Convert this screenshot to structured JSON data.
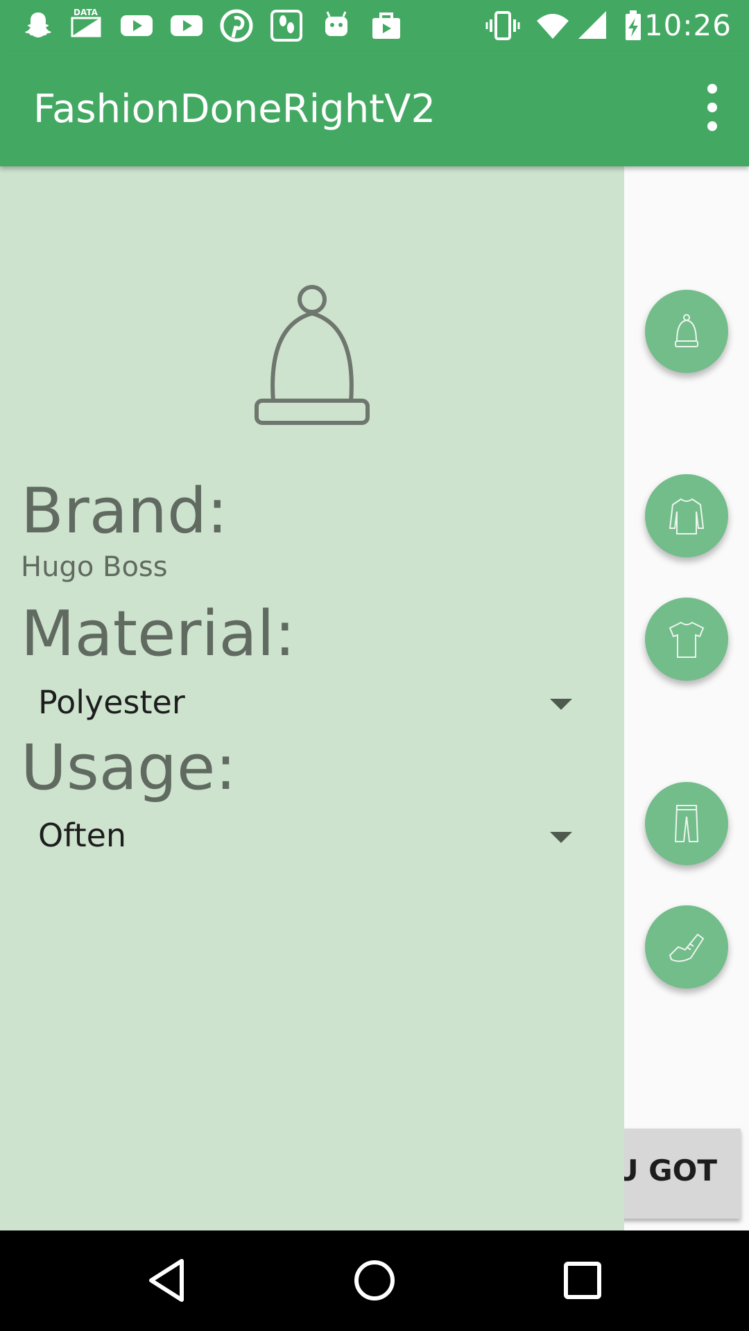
{
  "status_bar": {
    "time": "10:26",
    "left_icons": [
      "snapchat-icon",
      "data-icon",
      "youtube-icon",
      "youtube-icon",
      "pinterest-icon",
      "feet-icon",
      "android-icon",
      "shopping-bag-icon"
    ],
    "right_icons": [
      "vibrate-icon",
      "wifi-icon",
      "cell-signal-icon",
      "battery-charging-icon"
    ],
    "data_label": "DATA"
  },
  "app_bar": {
    "title": "FashionDoneRightV2",
    "overflow_icon": "more-vert-icon"
  },
  "item_panel": {
    "image_icon": "beanie-hat-icon",
    "brand_label": "Brand:",
    "brand_value": "Hugo Boss",
    "material_label": "Material:",
    "material_value": "Polyester",
    "usage_label": "Usage:",
    "usage_value": "Often"
  },
  "category_buttons": [
    {
      "icon": "hat-icon"
    },
    {
      "icon": "long-sleeve-icon"
    },
    {
      "icon": "tshirt-icon"
    },
    {
      "icon": "pants-icon"
    },
    {
      "icon": "shoe-icon"
    }
  ],
  "bottom_button": {
    "label": "OU GOT"
  },
  "nav_bar": {
    "icons": [
      "back-icon",
      "home-icon",
      "recents-icon"
    ]
  },
  "colors": {
    "primary": "#43a962",
    "panel": "#cde3ce",
    "fab": "#72bd8a",
    "label_text": "#606a60"
  }
}
